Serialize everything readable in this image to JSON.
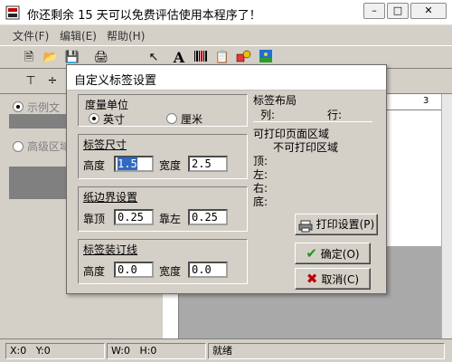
{
  "window": {
    "title": "你还剩余 15 天可以免费评估使用本程序了！"
  },
  "menu": {
    "file": "文件(F)",
    "edit": "编辑(E)",
    "help": "帮助(H)"
  },
  "left_panel": {
    "sample_text": "示例文",
    "advanced_zone": "高级区域"
  },
  "ruler": {
    "top_number": "3"
  },
  "status": {
    "x": "X:0",
    "y": "Y:0",
    "w": "W:0",
    "h": "H:0",
    "state": "就绪"
  },
  "dialog": {
    "title": "自定义标签设置",
    "units": {
      "title": "度量单位",
      "inch": "英寸",
      "cm": "厘米",
      "selected": "inch"
    },
    "label_size": {
      "title": "标签尺寸",
      "height_label": "高度",
      "height_value": "1.5",
      "width_label": "宽度",
      "width_value": "2.5"
    },
    "margins": {
      "title": "纸边界设置",
      "top_label": "靠顶",
      "top_value": "0.25",
      "left_label": "靠左",
      "left_value": "0.25"
    },
    "binding": {
      "title": "标签装订线",
      "height_label": "高度",
      "height_value": "0.0",
      "width_label": "宽度",
      "width_value": "0.0"
    },
    "layout": {
      "title": "标签布局",
      "columns_label": "列:",
      "rows_label": "行:",
      "printable_area": "可打印页面区域",
      "nonprintable_area": "不可打印区域",
      "top": "顶:",
      "left": "左:",
      "right": "右:",
      "bottom": "底:"
    },
    "buttons": {
      "print_setup": "打印设置(P)",
      "ok": "确定(O)",
      "cancel": "取消(C)"
    }
  }
}
